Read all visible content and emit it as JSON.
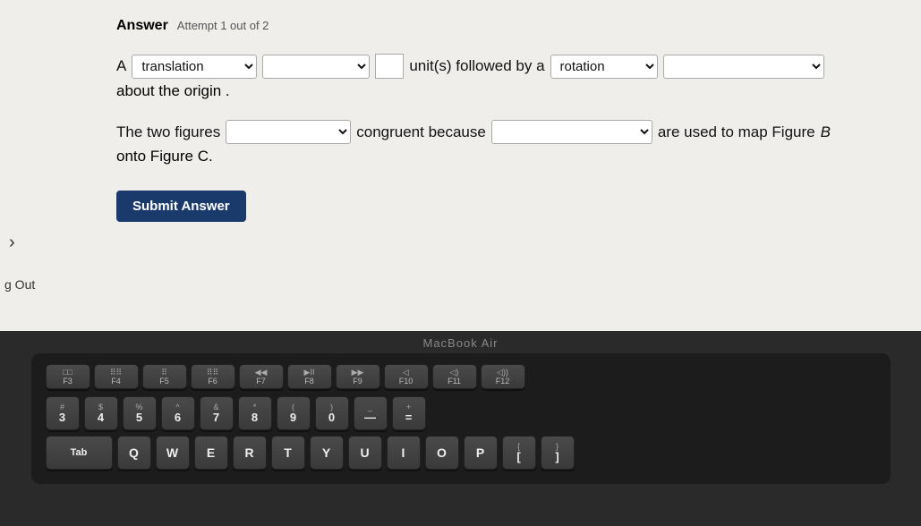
{
  "header": {
    "answer_label": "Answer",
    "attempt_text": "Attempt 1 out of 2"
  },
  "row1": {
    "prefix": "A",
    "dropdown1_options": [
      "translation"
    ],
    "dropdown1_selected": "translation",
    "dropdown2_options": [
      ""
    ],
    "dropdown2_selected": "",
    "unit_box_value": "",
    "units_text": "unit(s) followed by a",
    "dropdown3_options": [
      "rotation"
    ],
    "dropdown3_selected": "rotation",
    "dropdown4_options": [
      ""
    ],
    "dropdown4_selected": "",
    "line2": "about the origin ."
  },
  "row2": {
    "prefix": "The two figures",
    "dropdown1_options": [
      ""
    ],
    "dropdown1_selected": "",
    "middle_text": "congruent because",
    "dropdown2_options": [
      ""
    ],
    "dropdown2_selected": "",
    "suffix": "are used to map Figure",
    "figure_label": "B",
    "line2": "onto Figure C."
  },
  "submit_button": "Submit Answer",
  "sidebar": {
    "chevron": "›",
    "logout": "g Out"
  },
  "macbook_label": "MacBook Air",
  "keyboard": {
    "fn_row": [
      {
        "label": "20\nF3",
        "top": "20",
        "bottom": "F3"
      },
      {
        "label": "888\nF4",
        "top": "888",
        "bottom": "F4"
      },
      {
        "label": "...\nF5",
        "top": "...",
        "bottom": "F5"
      },
      {
        "label": "...\nF6",
        "top": "...",
        "bottom": "F6"
      },
      {
        "label": "◀◀\nF7",
        "top": "◀◀",
        "bottom": "F7"
      },
      {
        "label": "▶II\nF8",
        "top": "▶II",
        "bottom": "F8"
      },
      {
        "label": "▶▶\nF9",
        "top": "▶▶",
        "bottom": "F9"
      },
      {
        "label": "F10",
        "top": "◁",
        "bottom": "F10"
      },
      {
        "label": "F11",
        "top": "◁)",
        "bottom": "F11"
      },
      {
        "label": "F12",
        "top": "◁))",
        "bottom": "F12"
      }
    ],
    "number_row": [
      {
        "top": "#",
        "bottom": "3"
      },
      {
        "top": "$",
        "bottom": "4"
      },
      {
        "top": "%",
        "bottom": "5"
      },
      {
        "top": "^",
        "bottom": "6"
      },
      {
        "top": "&",
        "bottom": "7"
      },
      {
        "top": "*",
        "bottom": "8"
      },
      {
        "top": "(",
        "bottom": "9"
      },
      {
        "top": ")",
        "bottom": "0"
      },
      {
        "top": "_",
        "bottom": "-"
      },
      {
        "top": "+",
        "bottom": "="
      }
    ]
  }
}
